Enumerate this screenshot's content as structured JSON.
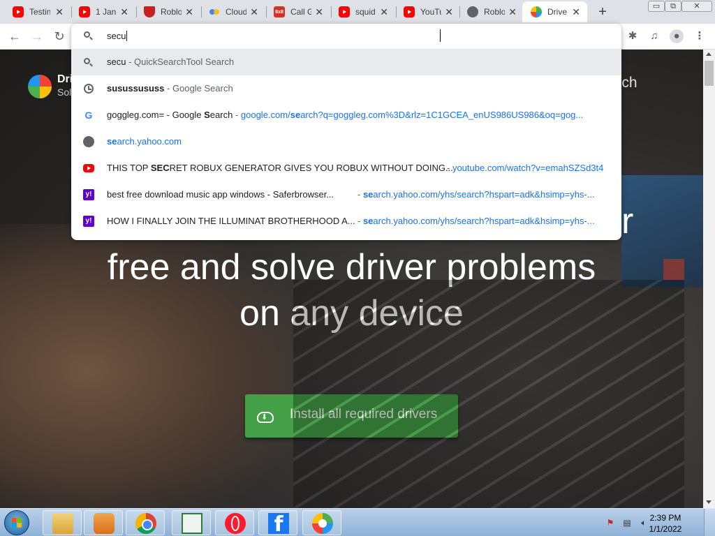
{
  "browser": {
    "tabs": [
      {
        "title": "Testin",
        "favicon": "youtube-icon"
      },
      {
        "title": "1 Jan",
        "favicon": "youtube-icon"
      },
      {
        "title": "Roblo",
        "favicon": "shield-icon"
      },
      {
        "title": "Cloud",
        "favicon": "cloud-icon"
      },
      {
        "title": "Call G",
        "favicon": "8x8-icon"
      },
      {
        "title": "squid",
        "favicon": "youtube-icon"
      },
      {
        "title": "YouTu",
        "favicon": "youtube-icon"
      },
      {
        "title": "Roblo",
        "favicon": "globe-icon"
      },
      {
        "title": "Drive",
        "favicon": "driver-icon",
        "active": true
      }
    ],
    "new_tab_label": "+",
    "window_controls": {
      "minimize": "▭",
      "restore": "⧉",
      "close": "✕"
    }
  },
  "omnibox": {
    "input_value": "secu",
    "suggestions": [
      {
        "icon": "search-icon",
        "text": "secu",
        "sep": " - ",
        "detail": "QuickSearchTool Search",
        "selected": true
      },
      {
        "icon": "history-clock-icon",
        "text_bold_prefix": "s",
        "text_rest": "usussususs",
        "sep": " - ",
        "detail": "Google Search"
      },
      {
        "icon": "google-icon",
        "text": "goggleg.com= - Google ",
        "text_bold": "S",
        "text_tail": "earch",
        "sep": " - ",
        "url_pre": "google.com/",
        "url_bold": "se",
        "url_post": "arch?q=goggleg.com%3D&rlz=1C1GCEA_enUS986US986&oq=gog..."
      },
      {
        "icon": "globe-icon",
        "url_bold": "se",
        "url_post": "arch.yahoo.com"
      },
      {
        "icon": "youtube-icon",
        "text_pre": "THIS TOP ",
        "text_bold": "SEC",
        "text_post": "RET ROBUX GENERATOR GIVES YOU ROBUX WITHOUT DOING...",
        "sep": " - ",
        "url": "youtube.com/watch?v=emahSZSd3t4"
      },
      {
        "icon": "yahoo-icon",
        "text": "best free download music app windows - Saferbrowser...",
        "sep": " - ",
        "url_bold": "se",
        "url_post": "arch.yahoo.com/yhs/search?hspart=adk&hsimp=yhs-..."
      },
      {
        "icon": "yahoo-icon",
        "text": "HOW I FINALLY JOIN THE ILLUMINAT BROTHERHOOD A...",
        "sep": " - ",
        "url_bold": "se",
        "url_post": "arch.yahoo.com/yhs/search?hspart=adk&hsimp=yhs-..."
      }
    ]
  },
  "page": {
    "logo_text_1": "Dri",
    "logo_text_2": "Sol",
    "nav_search": "earch",
    "hero_line_1_tail": "r",
    "hero_line_2": "free and solve driver problems",
    "hero_line_3": "on any device",
    "install_button": "Install all required drivers",
    "accent_color": "#43a047"
  },
  "taskbar": {
    "apps": [
      "windows-explorer-icon",
      "media-center-icon",
      "chrome-icon",
      "document-icon",
      "opera-icon",
      "facebook-icon",
      "chrome-canary-icon"
    ],
    "time": "2:39 PM",
    "date": "1/1/2022"
  }
}
